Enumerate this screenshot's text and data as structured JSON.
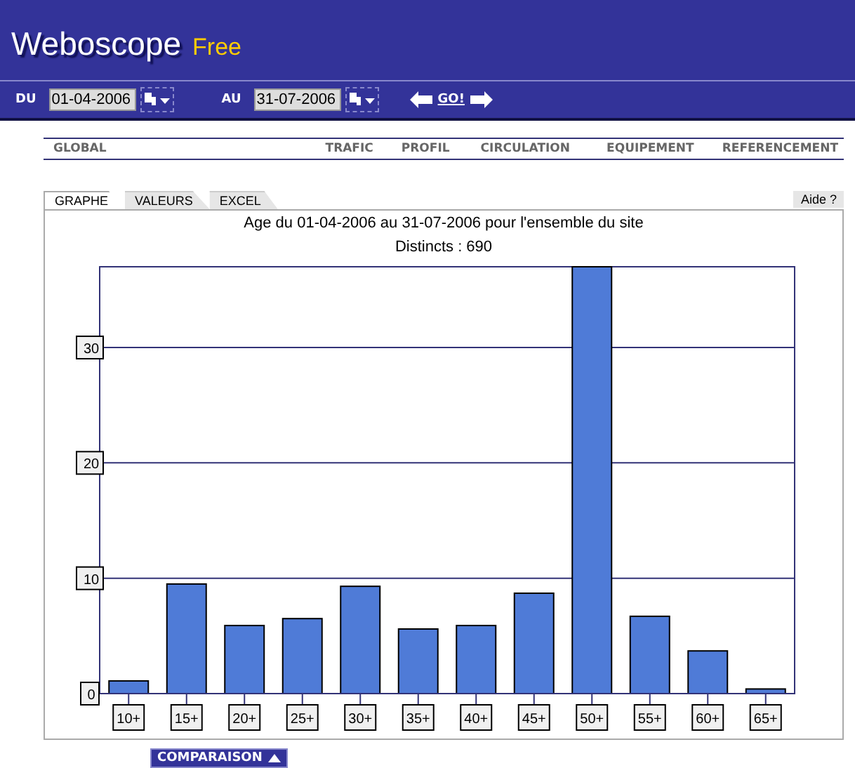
{
  "header": {
    "brand": "Weboscope",
    "edition": "Free"
  },
  "dates": {
    "from_label": "DU",
    "from_value": "01-04-2006",
    "to_label": "AU",
    "to_value": "31-07-2006",
    "go": "GO!"
  },
  "nav": [
    "GLOBAL",
    "TRAFIC",
    "PROFIL",
    "CIRCULATION",
    "EQUIPEMENT",
    "REFERENCEMENT"
  ],
  "tabs": [
    {
      "label": "GRAPHE",
      "selected": true
    },
    {
      "label": "VALEURS",
      "selected": false
    },
    {
      "label": "EXCEL",
      "selected": false
    }
  ],
  "help": "Aide ?",
  "chart_title": "Age du 01-04-2006 au 31-07-2006 pour l'ensemble du site",
  "chart_subtitle": "Distincts : 690",
  "chart_data": {
    "type": "bar",
    "categories": [
      "10+",
      "15+",
      "20+",
      "25+",
      "30+",
      "35+",
      "40+",
      "45+",
      "50+",
      "55+",
      "60+",
      "65+"
    ],
    "values": [
      1.1,
      9.5,
      5.9,
      6.5,
      9.3,
      5.6,
      5.9,
      8.7,
      37,
      6.7,
      3.7,
      0.4
    ],
    "ylim": [
      0,
      37
    ],
    "grid": true,
    "yticks": [
      0,
      10,
      20,
      30
    ]
  },
  "comparison_button": "COMPARAISON"
}
